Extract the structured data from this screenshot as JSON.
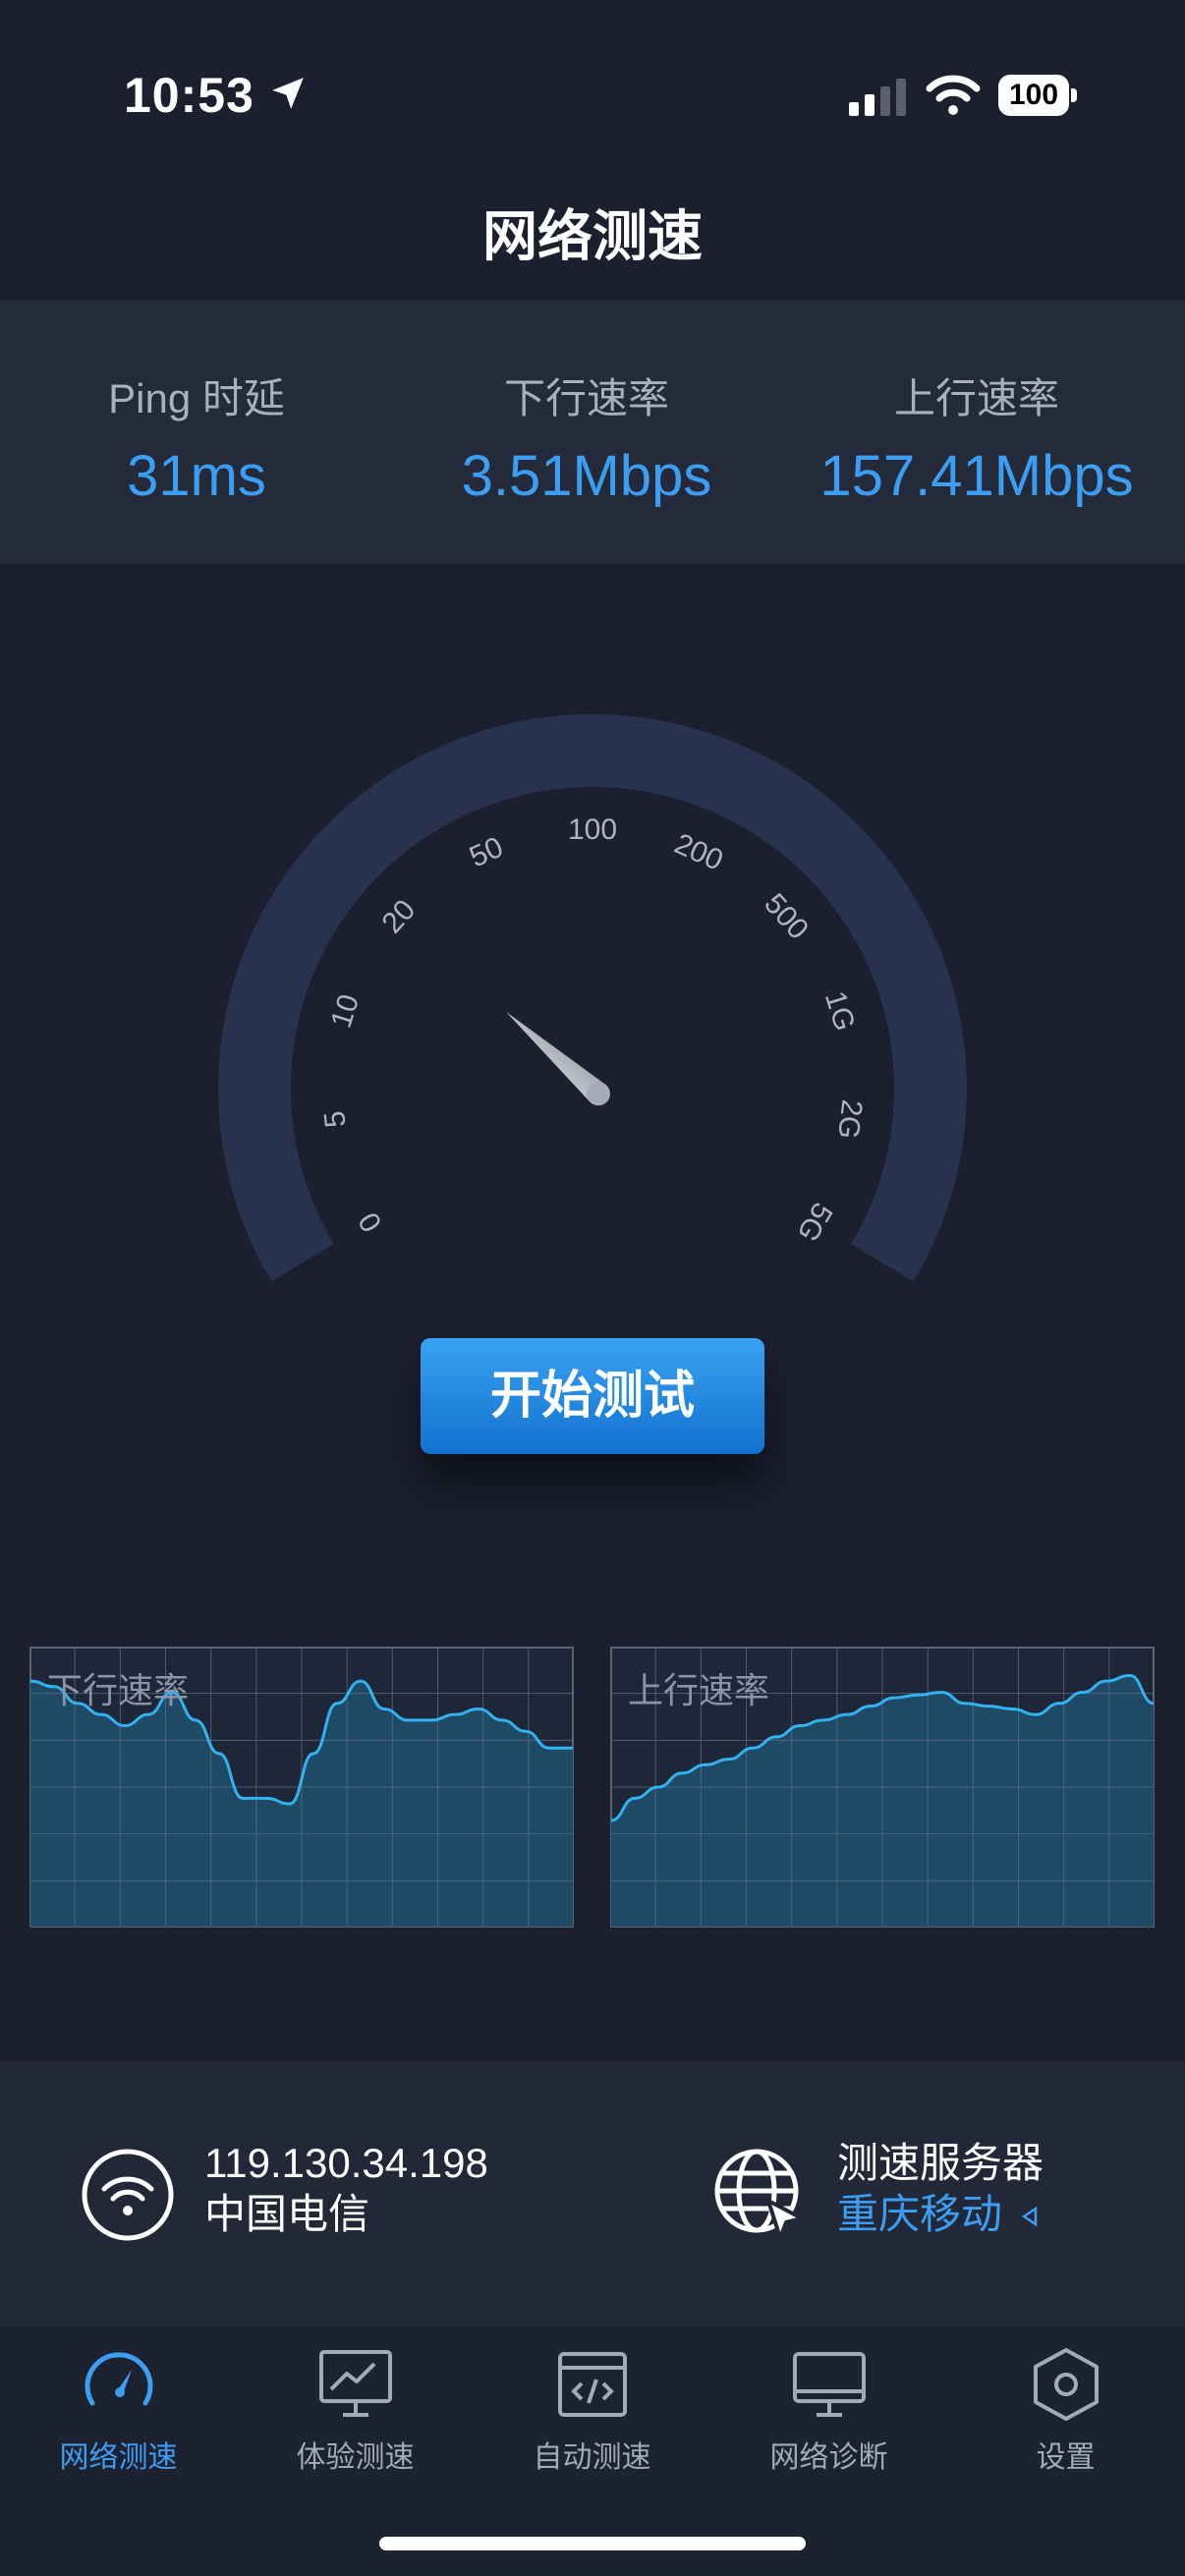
{
  "status_bar": {
    "time": "10:53",
    "battery": "100"
  },
  "page_title": "网络测速",
  "stats": {
    "ping": {
      "label": "Ping 时延",
      "value": "31ms"
    },
    "download": {
      "label": "下行速率",
      "value": "3.51Mbps"
    },
    "upload": {
      "label": "上行速率",
      "value": "157.41Mbps"
    }
  },
  "gauge": {
    "tick_labels": [
      "0",
      "5",
      "10",
      "20",
      "50",
      "100",
      "200",
      "500",
      "1G",
      "2G",
      "5G"
    ],
    "needle_value": "20"
  },
  "start_button": "开始测试",
  "charts": {
    "download_label": "下行速率",
    "upload_label": "上行速率",
    "download_line": [
      0.88,
      0.86,
      0.8,
      0.76,
      0.72,
      0.76,
      0.84,
      0.74,
      0.62,
      0.46,
      0.46,
      0.44,
      0.62,
      0.8,
      0.88,
      0.78,
      0.74,
      0.74,
      0.76,
      0.78,
      0.74,
      0.7,
      0.64,
      0.64
    ],
    "upload_line": [
      0.38,
      0.46,
      0.5,
      0.55,
      0.58,
      0.6,
      0.64,
      0.68,
      0.72,
      0.74,
      0.76,
      0.79,
      0.82,
      0.83,
      0.84,
      0.8,
      0.79,
      0.78,
      0.76,
      0.8,
      0.84,
      0.88,
      0.9,
      0.8
    ]
  },
  "network_info": {
    "ip": "119.130.34.198",
    "isp": "中国电信",
    "server_label": "测速服务器",
    "server_name": "重庆移动"
  },
  "tabs": [
    {
      "label": "网络测速",
      "icon": "speedometer-icon"
    },
    {
      "label": "体验测速",
      "icon": "chart-screen-icon"
    },
    {
      "label": "自动测速",
      "icon": "code-window-icon"
    },
    {
      "label": "网络诊断",
      "icon": "monitor-icon"
    },
    {
      "label": "设置",
      "icon": "hexagon-settings-icon"
    }
  ],
  "colors": {
    "accent": "#3c9ef2",
    "background": "#1b1f2e",
    "panel": "#242a3a",
    "gauge_arc": "#28324e"
  }
}
